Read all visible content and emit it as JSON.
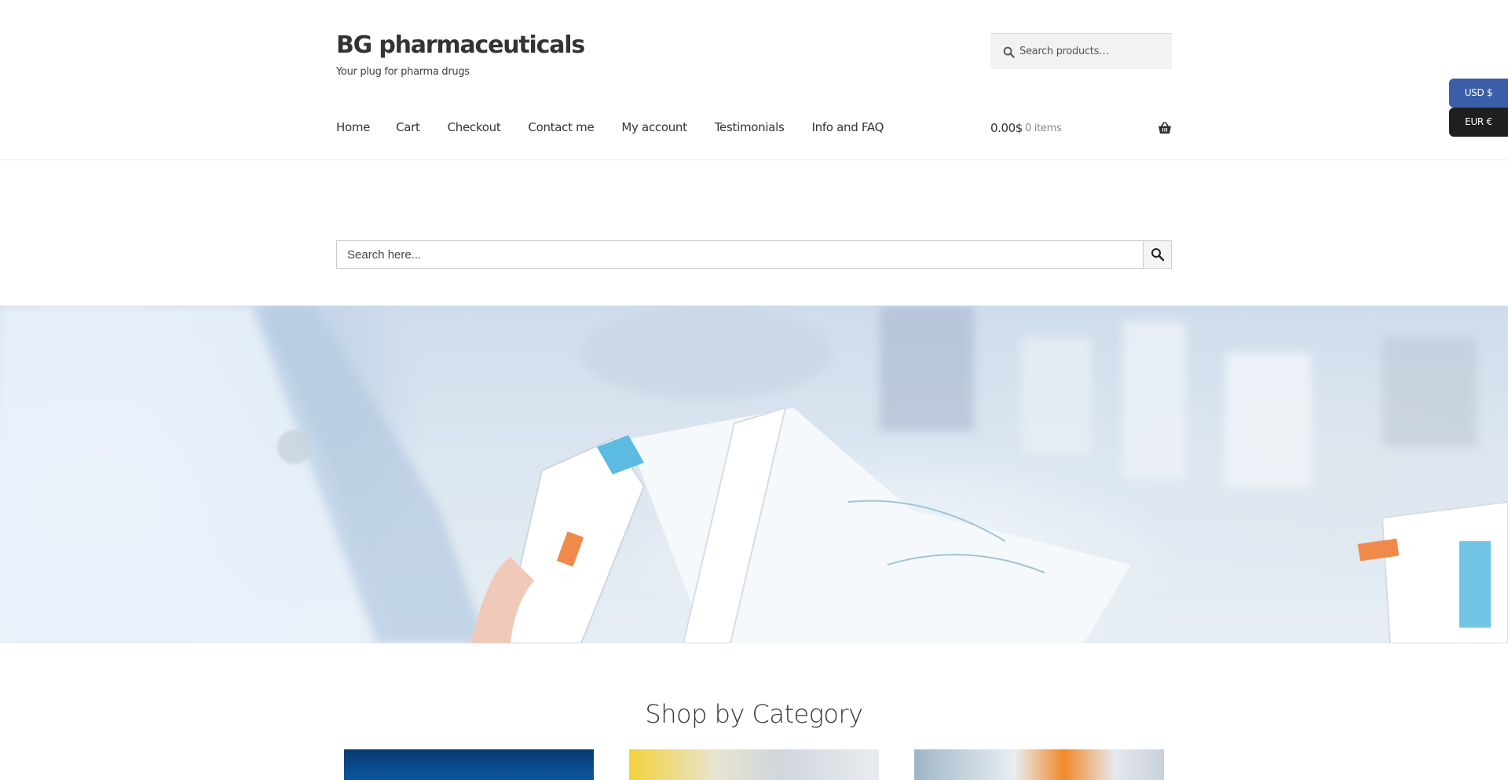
{
  "header": {
    "site_title": "BG pharmaceuticals",
    "tagline": "Your plug for pharma drugs",
    "search_placeholder": "Search products…"
  },
  "nav": {
    "items": [
      {
        "label": "Home"
      },
      {
        "label": "Cart"
      },
      {
        "label": "Checkout"
      },
      {
        "label": "Contact me"
      },
      {
        "label": "My account"
      },
      {
        "label": "Testimonials"
      },
      {
        "label": "Info and FAQ"
      }
    ]
  },
  "cart": {
    "amount": "0.00$",
    "count": "0 items"
  },
  "currency_switcher": {
    "usd_label": "USD $",
    "eur_label": "EUR €",
    "active_color": "#3a5ea8",
    "inactive_color": "#1f1f1f"
  },
  "main_search": {
    "placeholder": "Search here..."
  },
  "categories": {
    "title": "Shop by Category"
  },
  "icons": {
    "header_search": "search-icon",
    "cart": "basket-icon",
    "main_search": "search-icon"
  }
}
